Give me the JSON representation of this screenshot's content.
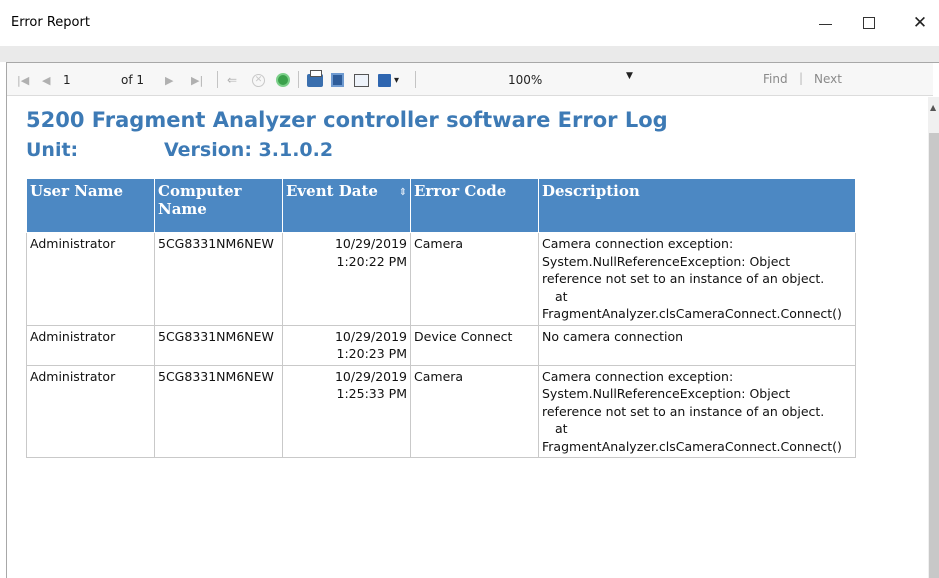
{
  "window": {
    "title": "Error Report",
    "min_glyph": "",
    "close_glyph": "✕"
  },
  "toolbar": {
    "first_page": "|◀",
    "prev_page": "◀",
    "page_current": "1",
    "page_of": "of 1",
    "next_page": "▶",
    "last_page": "▶|",
    "back": "⇐",
    "stop": "✕",
    "zoom_value": "100%",
    "zoom_caret": "▼",
    "export_caret": "▾",
    "find_label": "Find",
    "find_separator": "|",
    "next_label": "Next"
  },
  "report": {
    "title": "5200 Fragment Analyzer controller software Error Log",
    "unit_label": "Unit:",
    "version_label": "Version: 3.1.0.2",
    "columns": [
      "User Name",
      "Computer Name",
      "Event Date",
      "Error Code",
      "Description"
    ],
    "sort_glyph": "⇕",
    "rows": [
      {
        "user": "Administrator",
        "computer": "5CG8331NM6NEW",
        "date": "10/29/2019",
        "time": "1:20:22 PM",
        "code": "Camera",
        "description": "Camera connection exception: System.NullReferenceException: Object reference not set to an instance of an object.",
        "desc_at": "at",
        "desc_trace": "FragmentAnalyzer.clsCameraConnect.Connect()"
      },
      {
        "user": "Administrator",
        "computer": "5CG8331NM6NEW",
        "date": "10/29/2019",
        "time": "1:20:23 PM",
        "code": "Device Connect",
        "description": "No camera connection",
        "desc_at": "",
        "desc_trace": ""
      },
      {
        "user": "Administrator",
        "computer": "5CG8331NM6NEW",
        "date": "10/29/2019",
        "time": "1:25:33 PM",
        "code": "Camera",
        "description": "Camera connection exception: System.NullReferenceException: Object reference not set to an instance of an object.",
        "desc_at": "at",
        "desc_trace": "FragmentAnalyzer.clsCameraConnect.Connect()"
      }
    ]
  },
  "colors": {
    "accent": "#3d7ab5",
    "header_bg": "#4c88c3"
  }
}
